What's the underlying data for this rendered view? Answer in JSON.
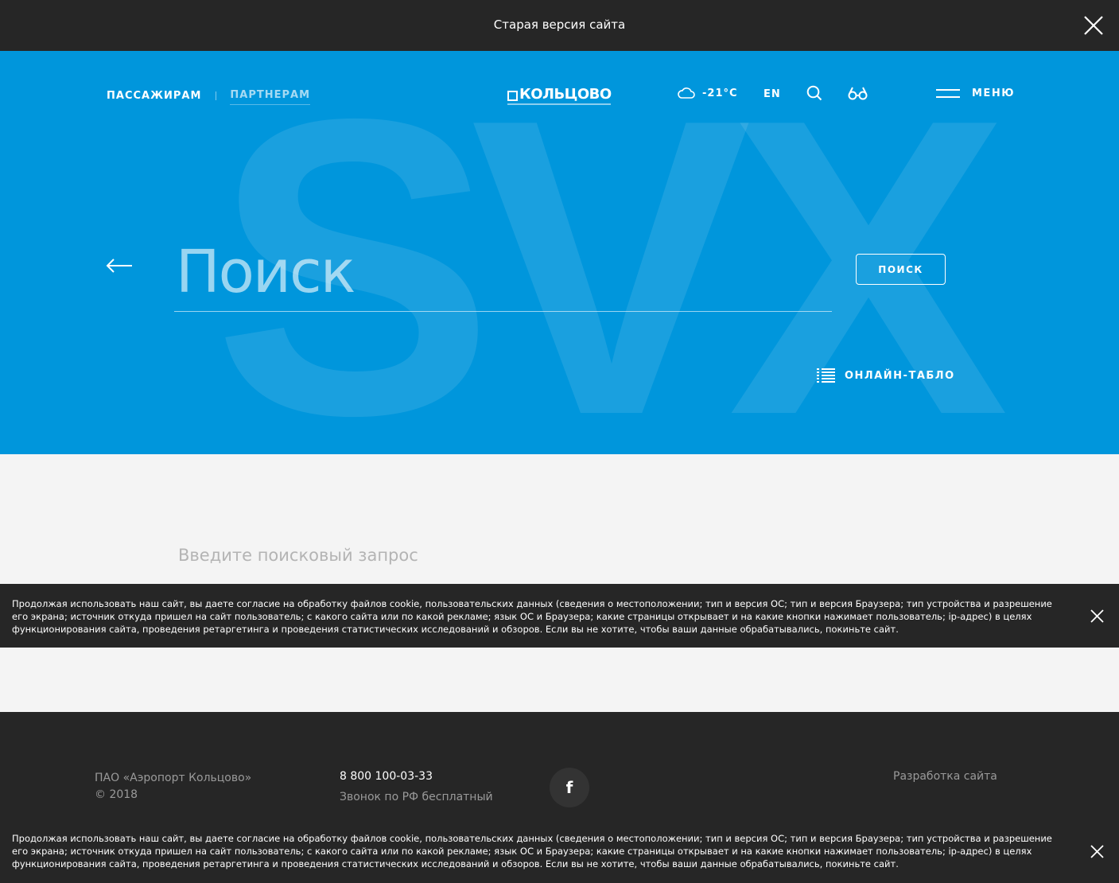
{
  "topbar": {
    "old_version_label": "Старая версия сайта",
    "close_icon": "close-icon"
  },
  "header": {
    "nav_passengers": "ПАССАЖИРАМ",
    "nav_partners": "ПАРТНЕРАМ",
    "logo_text": "КОЛЬЦОВО",
    "weather_temp": "-21°C",
    "weather_icon": "cloud-icon",
    "lang": "EN",
    "search_icon": "search-icon",
    "accessibility_icon": "glasses-icon",
    "menu_label": "МЕНЮ"
  },
  "hero": {
    "background_letters": "SVX",
    "search_placeholder": "Поиск",
    "search_button": "ПОИСК",
    "tablo_label": "ОНЛАЙН-ТАБЛО",
    "accent_color": "#0096dc"
  },
  "content": {
    "hint": "Введите поисковый запрос"
  },
  "cookie": {
    "text": "Продолжая использовать наш сайт, вы даете согласие на обработку файлов cookie, пользовательских данных (сведения о местоположении; тип и версия ОС; тип и версия Браузера; тип устройства и разрешение его экрана; источник откуда пришел на сайт пользователь; с какого сайта или по какой рекламе; язык ОС и Браузера; какие страницы открывает и на какие кнопки нажимает пользователь; ip-адрес) в целях функционирования сайта, проведения ретаргетинга и проведения статистических исследований и обзоров. Если вы не хотите, чтобы ваши данные обрабатывались, покиньте сайт."
  },
  "footer": {
    "company": "ПАО «Аэропорт Кольцово»",
    "copyright": "© 2018",
    "phone": "8 800 100-03-33",
    "phone_note": "Звонок по РФ бесплатный",
    "facebook_glyph": "f",
    "developer": "Разработка сайта"
  }
}
